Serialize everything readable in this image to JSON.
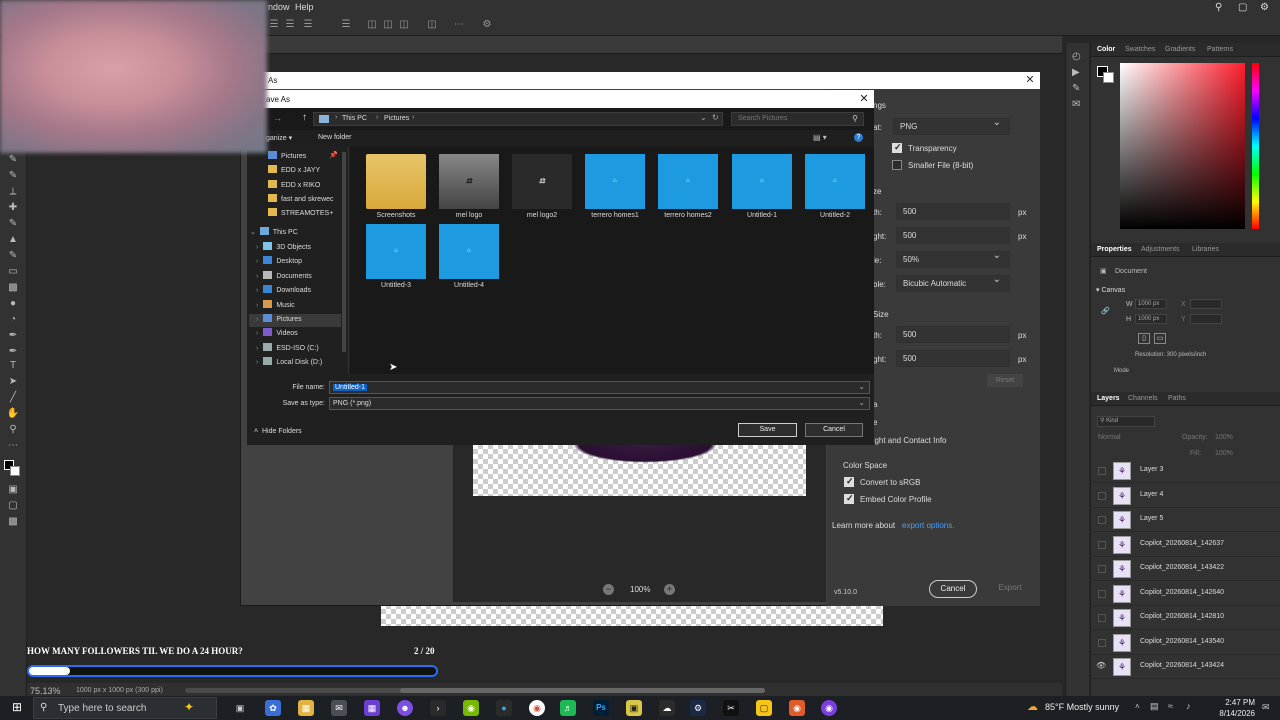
{
  "ps": {
    "menus": [
      "ndow",
      "Help"
    ],
    "zoom": "75.13%",
    "doc_dims": "1000 px x 1000 px (300 ppi)"
  },
  "panels": {
    "color_tabs": [
      "Color",
      "Swatches",
      "Gradients",
      "Patterns"
    ],
    "prop_tabs": [
      "Properties",
      "Adjustments",
      "Libraries"
    ],
    "document_label": "Document",
    "canvas_label": "Canvas",
    "w_label": "W",
    "w_value": "1000 px",
    "h_label": "H",
    "h_value": "1000 px",
    "x_label": "X",
    "y_label": "Y",
    "resolution": "Resolution: 300 pixels/inch",
    "mode_label": "Mode",
    "layers_tabs": [
      "Layers",
      "Channels",
      "Paths"
    ],
    "layers_filter": "Kind",
    "blend_mode": "Normal",
    "opacity_label": "Opacity:",
    "opacity_value": "100%",
    "fill_label": "Fill:",
    "fill_value": "100%",
    "layers": [
      {
        "name": "Layer 3"
      },
      {
        "name": "Layer 4"
      },
      {
        "name": "Layer 5"
      },
      {
        "name": "Copilot_20260814_142637"
      },
      {
        "name": "Copilot_20260814_143422"
      },
      {
        "name": "Copilot_20260814_142640"
      },
      {
        "name": "Copilot_20260814_142810"
      },
      {
        "name": "Copilot_20260814_143540"
      },
      {
        "name": "Copilot_20260814_143424"
      }
    ]
  },
  "export_dialog": {
    "title": "As",
    "settings_heading": "ngs",
    "format_label": "at:",
    "format_value": "PNG",
    "transparency_label": "Transparency",
    "smaller_file_label": "Smaller File (8-bit)",
    "size_heading": "ze",
    "width_label": "th:",
    "width_value": "500",
    "height_label": "ght:",
    "height_value": "500",
    "unit_px": "px",
    "scale_label": "le:",
    "scale_value": "50%",
    "resample_label": "ble:",
    "resample_value": "Bicubic Automatic",
    "canvas_size_heading": "Size",
    "canvas_width_value": "500",
    "canvas_height_value": "500",
    "reset_label": "Reset",
    "meta_heading": "a",
    "meta_none": "e",
    "copyright_label": "yright and Contact Info",
    "color_space_heading": "Color Space",
    "convert_srgb_label": "Convert to sRGB",
    "embed_profile_label": "Embed Color Profile",
    "learn_more": "Learn more about",
    "learn_link": "export options.",
    "version": "v5.10.0",
    "zoom": "100%",
    "cancel_label": "Cancel",
    "export_label": "Export"
  },
  "save_dialog": {
    "title": "ave As",
    "breadcrumb": [
      "This PC",
      "Pictures"
    ],
    "search_placeholder": "Search Pictures",
    "organize_label": "ganize",
    "new_folder_label": "New folder",
    "nav_items": [
      {
        "label": "Pictures"
      },
      {
        "label": "EDD x JAYY"
      },
      {
        "label": "EDD x RIKO"
      },
      {
        "label": "fast and skrewec"
      },
      {
        "label": "STREAMOTES+"
      },
      {
        "label": "This PC"
      },
      {
        "label": "3D Objects"
      },
      {
        "label": "Desktop"
      },
      {
        "label": "Documents"
      },
      {
        "label": "Downloads"
      },
      {
        "label": "Music"
      },
      {
        "label": "Pictures"
      },
      {
        "label": "Videos"
      },
      {
        "label": "ESD-ISO (C:)"
      },
      {
        "label": "Local Disk (D:)"
      }
    ],
    "files": [
      {
        "name": "Screenshots",
        "kind": "folder"
      },
      {
        "name": "mel logo",
        "kind": "gray"
      },
      {
        "name": "mel logo2",
        "kind": "dark"
      },
      {
        "name": "terrero homes1",
        "kind": "blue"
      },
      {
        "name": "terrero homes2",
        "kind": "blue"
      },
      {
        "name": "Untitled-1",
        "kind": "blue"
      },
      {
        "name": "Untitled-2",
        "kind": "blue"
      },
      {
        "name": "Untitled-3",
        "kind": "blue"
      },
      {
        "name": "Untitled-4",
        "kind": "blue"
      }
    ],
    "file_name_label": "File name:",
    "file_name_value": "Untitled-1",
    "save_type_label": "Save as type:",
    "save_type_value": "PNG (*.png)",
    "hide_folders_label": "Hide Folders",
    "save_label": "Save",
    "cancel_label": "Cancel"
  },
  "overlay": {
    "goal_text": "HOW MANY FOLLOWERS TIL WE DO A 24 HOUR?",
    "goal_count": "2 / 20",
    "goal_progress": 0.1
  },
  "taskbar": {
    "search_placeholder": "Type here to search",
    "weather": "85°F  Mostly sunny",
    "time": "2:47 PM",
    "date": "8/14/2026"
  }
}
